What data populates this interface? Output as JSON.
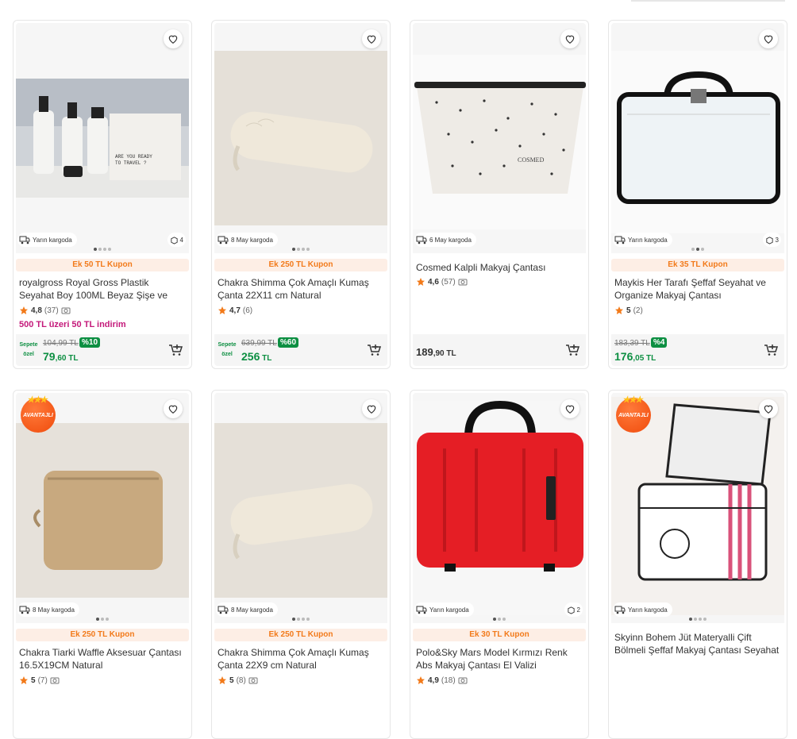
{
  "products": [
    {
      "shipping": "Yarın kargoda",
      "stock": "4",
      "coupon": "Ek 50 TL Kupon",
      "title": "royalgross Royal Gross Plastik Seyahat Boy 100ML Beyaz Şişe ve Kavanoz 4'l...",
      "rating": "4,8",
      "count": "(37)",
      "promo": "500 TL üzeri 50 TL indirim",
      "special": "Sepete özel",
      "old": "104,99 TL",
      "discount": "%10",
      "price_main": "79",
      "price_dec": ",60 TL"
    },
    {
      "shipping": "8 May kargoda",
      "stock": "",
      "coupon": "Ek 250 TL Kupon",
      "title": "Chakra Shimma Çok Amaçlı Kumaş Çanta 22X11 cm Natural",
      "rating": "4,7",
      "count": "(6)",
      "promo": "",
      "special": "Sepete özel",
      "old": "639,99 TL",
      "discount": "%60",
      "price_main": "256",
      "price_dec": " TL"
    },
    {
      "shipping": "6 May kargoda",
      "stock": "",
      "coupon": "",
      "title": "Cosmed Kalpli Makyaj Çantası",
      "rating": "4,6",
      "count": "(57)",
      "promo": "",
      "special": "",
      "old": "",
      "discount": "",
      "price_main": "189",
      "price_dec": ",90 TL"
    },
    {
      "shipping": "Yarın kargoda",
      "stock": "3",
      "coupon": "Ek 35 TL Kupon",
      "title": "Maykis Her Tarafı Şeffaf Seyahat ve Organize Makyaj Çantası",
      "rating": "5",
      "count": "(2)",
      "promo": "",
      "special": "",
      "old": "183,39 TL",
      "discount": "%4",
      "price_main": "176",
      "price_dec": ",05 TL"
    },
    {
      "badge": "AVANTAJLI",
      "shipping": "8 May kargoda",
      "stock": "",
      "coupon": "Ek 250 TL Kupon",
      "title": "Chakra Tiarki Waffle Aksesuar Çantası 16.5X19CM Natural",
      "rating": "5",
      "count": "(7)",
      "promo": "",
      "special": "",
      "old": "",
      "discount": "",
      "price_main": "",
      "price_dec": ""
    },
    {
      "shipping": "8 May kargoda",
      "stock": "",
      "coupon": "Ek 250 TL Kupon",
      "title": "Chakra Shimma Çok Amaçlı Kumaş Çanta 22X9 cm Natural",
      "rating": "5",
      "count": "(8)",
      "promo": "",
      "special": "",
      "old": "",
      "discount": "",
      "price_main": "",
      "price_dec": ""
    },
    {
      "shipping": "Yarın kargoda",
      "stock": "2",
      "coupon": "Ek 30 TL Kupon",
      "title": "Polo&Sky Mars Model Kırmızı Renk Abs Makyaj Çantası El Valizi",
      "rating": "4,9",
      "count": "(18)",
      "promo": "",
      "special": "",
      "old": "",
      "discount": "",
      "price_main": "",
      "price_dec": ""
    },
    {
      "badge": "AVANTAJLI",
      "shipping": "Yarın kargoda",
      "stock": "",
      "coupon": "",
      "title": "Skyinn Bohem Jüt Materyalli Çift Bölmeli Şeffaf Makyaj Çantası Seyahat ve...",
      "rating": "",
      "count": "",
      "promo": "",
      "special": "",
      "old": "",
      "discount": "",
      "price_main": "",
      "price_dec": ""
    }
  ],
  "icons": {
    "favorite": "heart-icon",
    "shipping": "truck-icon",
    "stock": "box-icon",
    "rating": "star-icon",
    "photo": "camera-icon",
    "cart": "add-to-cart-icon"
  },
  "colors": {
    "coupon_bg": "#fdeee5",
    "coupon_text": "#f27a1a",
    "price_green": "#0d8f42",
    "promo_pink": "#c4197a",
    "star": "#f27a1a"
  }
}
